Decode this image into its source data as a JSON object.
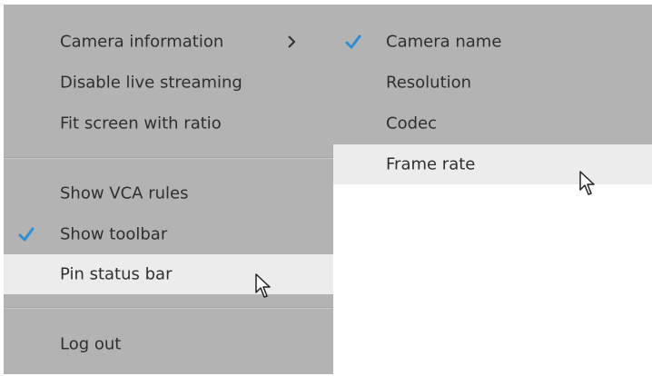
{
  "colors": {
    "menu_bg": "#b3b3b3",
    "hover_bg": "#ececec",
    "check": "#2a8fd6",
    "text": "#2f2f2f"
  },
  "main_menu": {
    "items": [
      {
        "label": "Camera information",
        "has_submenu": true,
        "checked": false
      },
      {
        "label": "Disable live streaming",
        "checked": false
      },
      {
        "label": "Fit screen with ratio",
        "checked": false
      },
      {
        "label": "Show VCA rules",
        "checked": false
      },
      {
        "label": "Show toolbar",
        "checked": true
      },
      {
        "label": "Pin status bar",
        "checked": false,
        "highlighted": true
      },
      {
        "label": "Log out",
        "checked": false
      }
    ]
  },
  "sub_menu": {
    "items": [
      {
        "label": "Camera name",
        "checked": true
      },
      {
        "label": "Resolution",
        "checked": false
      },
      {
        "label": "Codec",
        "checked": false
      },
      {
        "label": "Frame rate",
        "checked": false,
        "highlighted": true
      }
    ]
  },
  "icons": {
    "check": "check-icon",
    "submenu": "chevron-right-icon",
    "cursor": "mouse-pointer-icon"
  }
}
